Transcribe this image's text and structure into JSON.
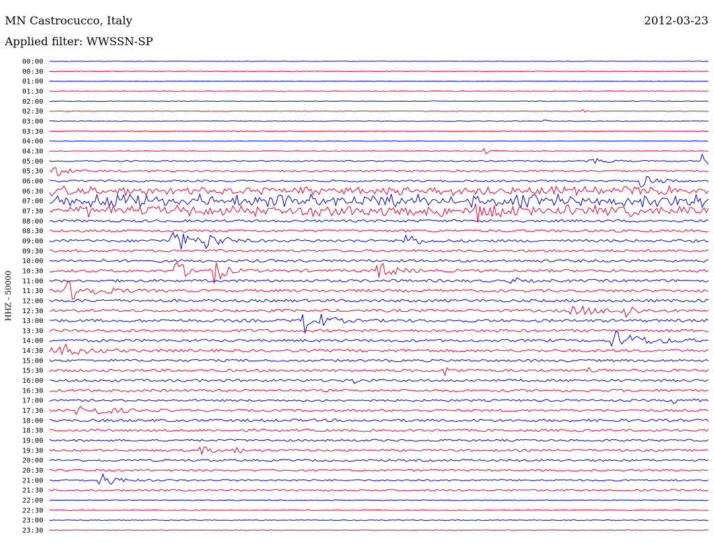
{
  "header": {
    "station": "MN Castrocucco, Italy",
    "date": "2012-03-23",
    "filter": "Applied filter: WWSSN-SP"
  },
  "chart_data": {
    "type": "line",
    "channel_label": "HHZ - 50000",
    "colors": {
      "odd": "#0000ff",
      "even": "#ff0033"
    },
    "time_labels": [
      "00:00",
      "00:30",
      "01:00",
      "01:30",
      "02:00",
      "02:30",
      "03:00",
      "03:30",
      "04:00",
      "04:30",
      "05:00",
      "05:30",
      "06:00",
      "06:30",
      "07:00",
      "07:30",
      "08:00",
      "08:30",
      "09:00",
      "09:30",
      "10:00",
      "10:30",
      "11:00",
      "11:30",
      "12:00",
      "12:30",
      "13:00",
      "13:30",
      "14:00",
      "14:30",
      "15:00",
      "15:30",
      "16:00",
      "16:30",
      "17:00",
      "17:30",
      "18:00",
      "18:30",
      "19:00",
      "19:30",
      "20:00",
      "20:30",
      "21:00",
      "21:30",
      "22:00",
      "22:30",
      "23:00",
      "23:30"
    ],
    "noise_level": [
      0.3,
      0.4,
      0.3,
      0.4,
      0.4,
      0.4,
      0.4,
      0.4,
      0.4,
      0.5,
      0.9,
      1.2,
      1.3,
      4.0,
      5.5,
      5.0,
      1.8,
      1.8,
      1.9,
      1.8,
      1.9,
      1.9,
      1.9,
      1.9,
      2.0,
      2.0,
      2.0,
      2.0,
      2.0,
      1.9,
      1.8,
      1.9,
      1.8,
      1.8,
      1.5,
      1.6,
      2.0,
      1.7,
      1.5,
      1.6,
      1.5,
      1.3,
      1.2,
      1.2,
      0.6,
      0.6,
      0.6,
      0.5
    ],
    "events": [
      {
        "trace": 5,
        "pos": 0.81,
        "amp": 3,
        "width": 0.004
      },
      {
        "trace": 6,
        "pos": 0.75,
        "amp": 4,
        "width": 0.004
      },
      {
        "trace": 9,
        "pos": 0.66,
        "amp": 6,
        "width": 0.006
      },
      {
        "trace": 10,
        "pos": 0.82,
        "amp": 6,
        "width": 0.02
      },
      {
        "trace": 10,
        "pos": 0.99,
        "amp": 12,
        "width": 0.01
      },
      {
        "trace": 11,
        "pos": 0.01,
        "amp": 9,
        "width": 0.015
      },
      {
        "trace": 12,
        "pos": 0.9,
        "amp": 10,
        "width": 0.02
      },
      {
        "trace": 15,
        "pos": 0.65,
        "amp": 11,
        "width": 0.012
      },
      {
        "trace": 18,
        "pos": 0.19,
        "amp": 18,
        "width": 0.02
      },
      {
        "trace": 18,
        "pos": 0.24,
        "amp": 12,
        "width": 0.02
      },
      {
        "trace": 18,
        "pos": 0.54,
        "amp": 14,
        "width": 0.014
      },
      {
        "trace": 21,
        "pos": 0.19,
        "amp": 14,
        "width": 0.02
      },
      {
        "trace": 21,
        "pos": 0.25,
        "amp": 22,
        "width": 0.012
      },
      {
        "trace": 21,
        "pos": 0.5,
        "amp": 13,
        "width": 0.02
      },
      {
        "trace": 22,
        "pos": 0.7,
        "amp": 8,
        "width": 0.008
      },
      {
        "trace": 23,
        "pos": 0.03,
        "amp": 14,
        "width": 0.035
      },
      {
        "trace": 25,
        "pos": 0.8,
        "amp": 6,
        "width": 0.04
      },
      {
        "trace": 25,
        "pos": 0.87,
        "amp": 18,
        "width": 0.01
      },
      {
        "trace": 26,
        "pos": 0.39,
        "amp": 24,
        "width": 0.02
      },
      {
        "trace": 28,
        "pos": 0.86,
        "amp": 12,
        "width": 0.04
      },
      {
        "trace": 29,
        "pos": 0.01,
        "amp": 12,
        "width": 0.03
      },
      {
        "trace": 31,
        "pos": 0.6,
        "amp": 7,
        "width": 0.01
      },
      {
        "trace": 31,
        "pos": 0.82,
        "amp": 4,
        "width": 0.01
      },
      {
        "trace": 32,
        "pos": 0.46,
        "amp": 6,
        "width": 0.006
      },
      {
        "trace": 34,
        "pos": 0.95,
        "amp": 4,
        "width": 0.02
      },
      {
        "trace": 35,
        "pos": 0.05,
        "amp": 8,
        "width": 0.04
      },
      {
        "trace": 39,
        "pos": 0.23,
        "amp": 5,
        "width": 0.02
      },
      {
        "trace": 39,
        "pos": 0.28,
        "amp": 4,
        "width": 0.015
      },
      {
        "trace": 42,
        "pos": 0.08,
        "amp": 10,
        "width": 0.02
      }
    ]
  }
}
